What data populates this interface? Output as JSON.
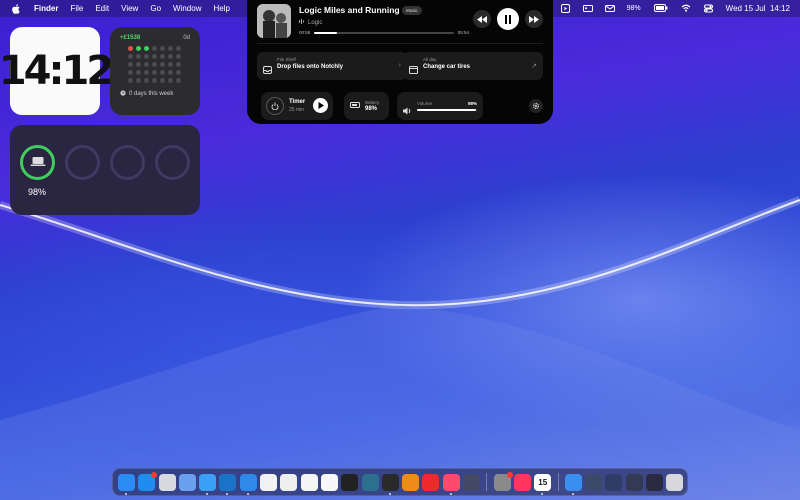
{
  "menubar": {
    "app_name": "Finder",
    "menus": [
      "File",
      "Edit",
      "View",
      "Go",
      "Window",
      "Help"
    ],
    "battery": "98%",
    "datetime": "Wed 15 Jul  14:12",
    "status_icons": [
      "shazam-icon",
      "play-circle-icon",
      "media-box-icon",
      "id-card-icon",
      "mail-icon",
      "battery-icon",
      "wifi-icon",
      "control-center-icon"
    ]
  },
  "widgets": {
    "clock": {
      "time": "14:12"
    },
    "streak": {
      "count": "+£1538",
      "days": "0d",
      "footer": "0 days this week"
    },
    "battery": {
      "percent": "98%"
    }
  },
  "notch": {
    "track_title": "Logic Miles and Running",
    "source_tag": "Music",
    "artist": "Logic",
    "elapsed": "00:58",
    "duration": "05:54",
    "progress": 0.16,
    "file_shelf": {
      "label": "File Shelf",
      "action": "Drop files onto Notchly"
    },
    "reminder": {
      "label": "All day",
      "title": "Change car tires"
    },
    "timer": {
      "title": "Timer",
      "duration": "25 min"
    },
    "battery": {
      "label": "Battery",
      "value": "98%"
    },
    "volume": {
      "label": "Volume",
      "value": "98%",
      "level": 0.98
    }
  },
  "dock": {
    "date_icon_day": "15",
    "apps": [
      {
        "name": "finder-icon",
        "color": "#2b8cf5"
      },
      {
        "name": "app-store-icon",
        "color": "#1f8df0",
        "badge": true
      },
      {
        "name": "launchpad-icon",
        "color": "#d9d9e0"
      },
      {
        "name": "preview-icon",
        "color": "#6ba0f0"
      },
      {
        "name": "safari-icon",
        "color": "#3a9ff5"
      },
      {
        "name": "vscode-icon",
        "color": "#1b73c8"
      },
      {
        "name": "xcode-icon",
        "color": "#2e89e8"
      },
      {
        "name": "numbers-icon",
        "color": "#f2f2f2"
      },
      {
        "name": "notes-icon",
        "color": "#eeeeee"
      },
      {
        "name": "freeform-icon",
        "color": "#f5f5f5"
      },
      {
        "name": "reminders-icon",
        "color": "#f7f7f7"
      },
      {
        "name": "activity-monitor-icon",
        "color": "#222222"
      },
      {
        "name": "3d-app-icon",
        "color": "#2c6f8f"
      },
      {
        "name": "terminal-icon",
        "color": "#2a2a2a"
      },
      {
        "name": "keynote-icon",
        "color": "#f08a1c"
      },
      {
        "name": "youtube-icon",
        "color": "#ee2b2b"
      },
      {
        "name": "music-app-icon",
        "color": "#ff4b6b"
      },
      {
        "name": "davinci-icon",
        "color": "#444a66"
      },
      {
        "name": "system-settings-icon",
        "color": "#8a8a8a",
        "badge": true
      },
      {
        "name": "apple-music-icon",
        "color": "#ff375f"
      },
      {
        "name": "calendar-icon",
        "color": "#ffffff"
      },
      {
        "name": "downloads-folder-icon",
        "color": "#3a8ef0"
      },
      {
        "name": "screenshot-1-icon",
        "color": "#3c4a6a"
      },
      {
        "name": "screenshot-2-icon",
        "color": "#2d3d66"
      },
      {
        "name": "screenshot-3-icon",
        "color": "#333a55"
      },
      {
        "name": "screenshot-4-icon",
        "color": "#2a2a40"
      },
      {
        "name": "trash-icon",
        "color": "#d8d8dc"
      }
    ]
  }
}
